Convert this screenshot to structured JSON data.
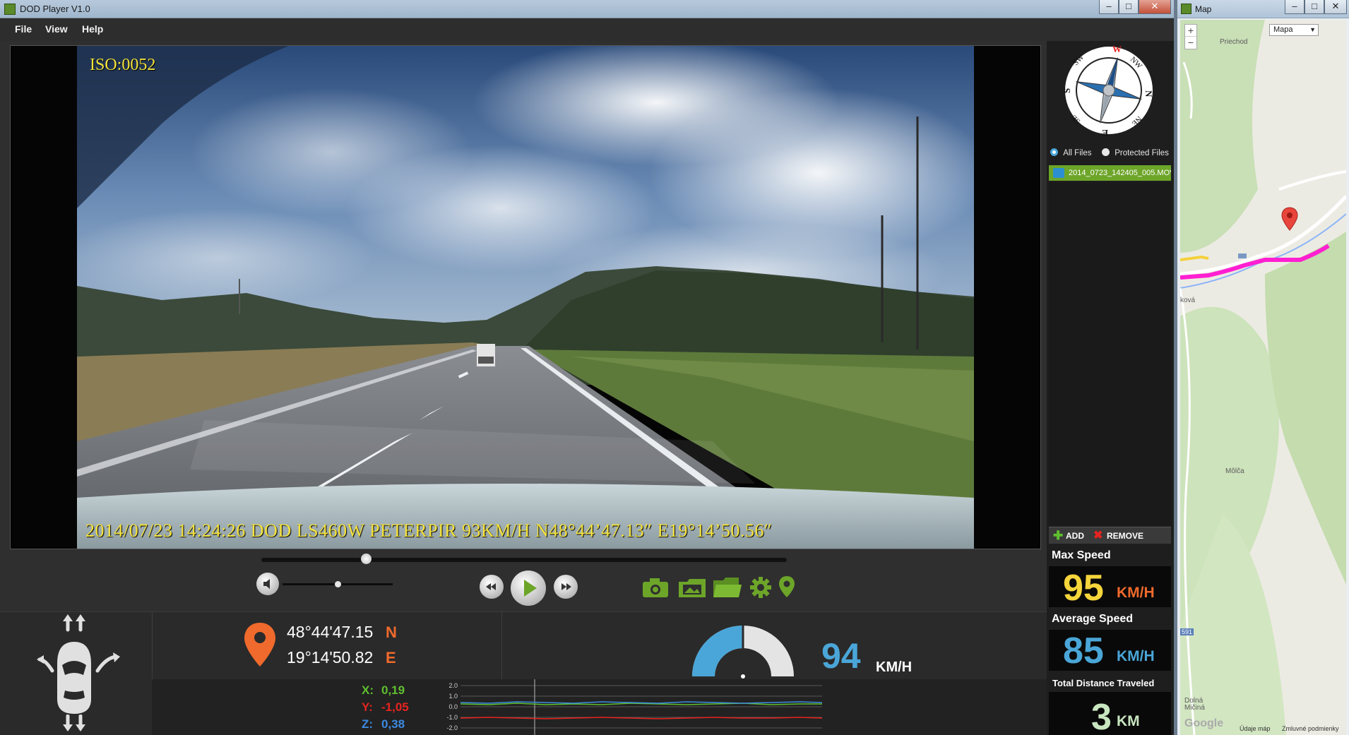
{
  "player": {
    "title": "DOD Player V1.0",
    "window_buttons": [
      "–",
      "□",
      "✕"
    ],
    "menu": [
      "File",
      "View",
      "Help"
    ],
    "osd": {
      "iso": "ISO:0052",
      "overlay": "2014/07/23 14:24:26 DOD LS460W  PETERPIR  93KM/H N48°44’47.13″ E19°14’50.56″"
    },
    "compass": {
      "labels": [
        "W",
        "NW",
        "N",
        "NE",
        "E",
        "SE",
        "S",
        "SW"
      ]
    },
    "file_filter": {
      "all": "All Files",
      "protected": "Protected Files",
      "selected": "all"
    },
    "files": [
      "2014_0723_142405_005.MOV"
    ],
    "file_actions": {
      "add": "ADD",
      "remove": "REMOVE"
    },
    "stats": {
      "max_speed_label": "Max Speed",
      "max_speed": "95",
      "max_speed_unit": "KM/H",
      "avg_speed_label": "Average Speed",
      "avg_speed": "85",
      "avg_speed_unit": "KM/H",
      "distance_label": "Total Distance Traveled",
      "distance": "3",
      "distance_unit": "KM"
    },
    "playback": {
      "progress": 0.2,
      "volume": 0.5
    },
    "toolbar_icons": [
      "camera-icon",
      "image-folder-icon",
      "folder-icon",
      "gear-icon",
      "location-pin-icon"
    ],
    "gps": {
      "lat": "48°44'47.15",
      "lat_dir": "N",
      "lon": "19°14'50.82",
      "lon_dir": "E"
    },
    "gsensor": {
      "x_label": "X:",
      "x": "0,19",
      "y_label": "Y:",
      "y": "-1,05",
      "z_label": "Z:",
      "z": "0,38",
      "ticks": [
        "2.0",
        "1.0",
        "0.0",
        "-1.0",
        "-2.0"
      ],
      "colors": {
        "x": "#5fbf2f",
        "y": "#e8231f",
        "z": "#3c8ae0"
      }
    },
    "speed": {
      "value": "94",
      "unit": "KM/H",
      "gauge_fraction": 0.5
    },
    "accent": {
      "orange": "#ef6a2c",
      "speed_blue": "#4aa6d8",
      "yellow": "#f5d53b",
      "mint": "#c8e6c0"
    }
  },
  "map": {
    "title": "Map",
    "window_buttons": [
      "–",
      "□",
      "✕"
    ],
    "map_type": "Mapa",
    "zoom_in": "+",
    "zoom_out": "−",
    "place_labels": [
      "Priechod",
      "Môlča",
      "Dolná Mičiná",
      "ková"
    ],
    "road_number": "591",
    "footer": [
      "Údaje máp",
      "Zmluvné podmienky"
    ],
    "logo": "Google"
  }
}
